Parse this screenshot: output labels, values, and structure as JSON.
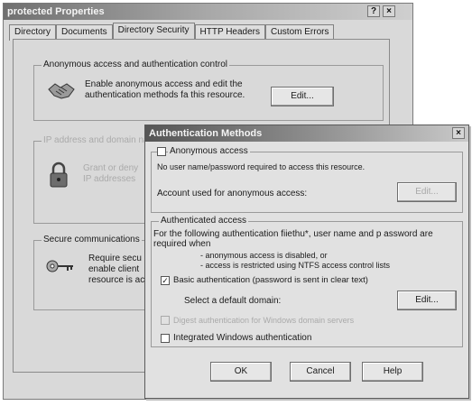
{
  "properties_window": {
    "title": "protected Properties",
    "help_button": "?",
    "close_button": "×",
    "tabs": [
      "Directory",
      "Documents",
      "Directory Security",
      "HTTP Headers",
      "Custom Errors"
    ],
    "anonymous_group": {
      "label": "Anonymous access and authentication control",
      "line1": "Enable anonymous access and edit the",
      "line2": "authentication methods fa this resource.",
      "edit_label": "Edit..."
    },
    "ip_group": {
      "label": "IP address and domain name restrictions",
      "line1": "Grant or deny",
      "line2": "IP addresses"
    },
    "secure_group": {
      "label": "Secure communications",
      "line1": "Require secu",
      "line2": "enable client",
      "line3": "resource is ac"
    }
  },
  "auth_dialog": {
    "title": "Authentication Methods",
    "close_button": "×",
    "anonymous_label": "Anonymous access",
    "anonymous_checked": false,
    "anonymous_desc": "No user name/password required to access this resource.",
    "account_label": "Account used for anonymous access:",
    "account_edit_label": "Edit...",
    "authenticated_group_label": "Authenticated access",
    "auth_desc_line1": "For the following authentication fiiethu*, user name and p assword are",
    "auth_desc_line2": "required when",
    "auth_bullet1": "- anonymous access is disabled, or",
    "auth_bullet2": "- access is restricted using NTFS access control lists",
    "basic_label": "Basic authentication (password is sent in clear text)",
    "basic_checked": true,
    "default_domain_label": "Select a default domain:",
    "domain_edit_label": "Edit...",
    "digest_label": "Digest authentication for Windows domain servers",
    "digest_checked": false,
    "integrated_label": "Integrated Windows authentication",
    "integrated_checked": false,
    "ok_label": "OK",
    "cancel_label": "Cancel",
    "help_label": "Help"
  }
}
